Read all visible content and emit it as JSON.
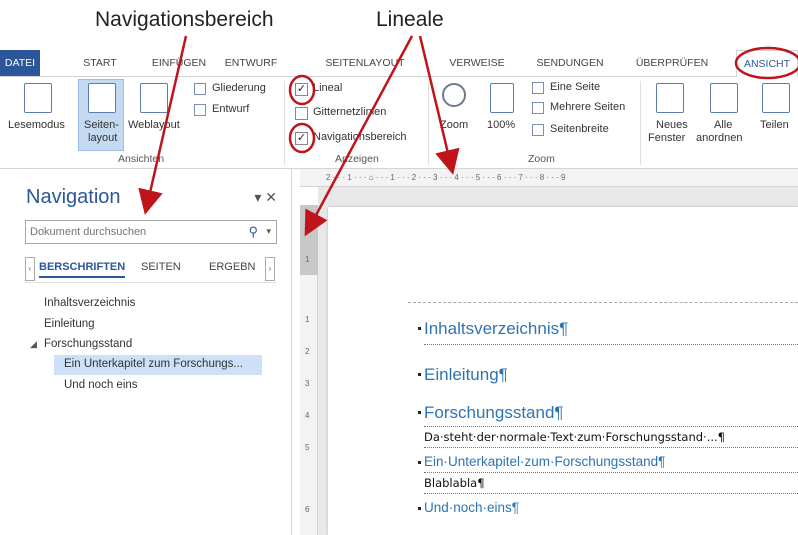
{
  "annotations": {
    "nav_area": "Navigationsbereich",
    "rulers": "Lineale"
  },
  "ribbon_tabs": [
    "DATEI",
    "START",
    "EINFÜGEN",
    "ENTWURF",
    "SEITENLAYOUT",
    "VERWEISE",
    "SENDUNGEN",
    "ÜBERPRÜFEN",
    "ANSICHT"
  ],
  "ribbon": {
    "views": {
      "read_mode": "Lesemodus",
      "print_layout_1": "Seiten-",
      "print_layout_2": "layout",
      "web_layout": "Weblayout",
      "outline": "Gliederung",
      "draft": "Entwurf",
      "group": "Ansichten"
    },
    "show": {
      "ruler": "Lineal",
      "gridlines": "Gitternetzlinien",
      "nav_pane": "Navigationsbereich",
      "group": "Anzeigen",
      "ruler_checked": "✓",
      "nav_checked": "✓"
    },
    "zoom": {
      "zoom": "Zoom",
      "hundred": "100%",
      "one_page": "Eine Seite",
      "multi_page": "Mehrere Seiten",
      "page_width": "Seitenbreite",
      "group": "Zoom"
    },
    "window": {
      "new_window_1": "Neues",
      "new_window_2": "Fenster",
      "arrange_all_1": "Alle",
      "arrange_all_2": "anordnen",
      "split": "Teilen"
    }
  },
  "navigation": {
    "title": "Navigation",
    "controls": "▾ ✕",
    "search_placeholder": "Dokument durchsuchen",
    "tabs": {
      "headings": "BERSCHRIFTEN",
      "pages": "SEITEN",
      "results": "ERGEBN"
    },
    "headings": [
      "Inhaltsverzeichnis",
      "Einleitung",
      "Forschungsstand",
      "Ein Unterkapitel zum Forschungs...",
      "Und noch eins"
    ]
  },
  "document": {
    "h_toc": "Inhaltsverzeichnis¶",
    "h_intro": "Einleitung¶",
    "h_research": "Forschungsstand¶",
    "body_research": "Da·steht·der·normale·Text·zum·Forschungsstand·...¶",
    "h_sub": "Ein·Unterkapitel·zum·Forschungsstand¶",
    "body_sub": "Blablabla¶",
    "h_more": "Und·noch·eins¶"
  },
  "rulers": {
    "h_marks": "2 · · · 1 · · · ⌂ · · · 1 · · · 2 · · · 3 · · · 4 · · · 5 · · · 6 · · · 7 · · · 8 · · · 9",
    "v_marks": [
      "2",
      "1",
      "1",
      "2",
      "3",
      "4",
      "5",
      "6"
    ]
  },
  "colors": {
    "accent": "#2b579a",
    "annotation_red": "#c0141c",
    "heading_blue": "#2e74b5"
  }
}
